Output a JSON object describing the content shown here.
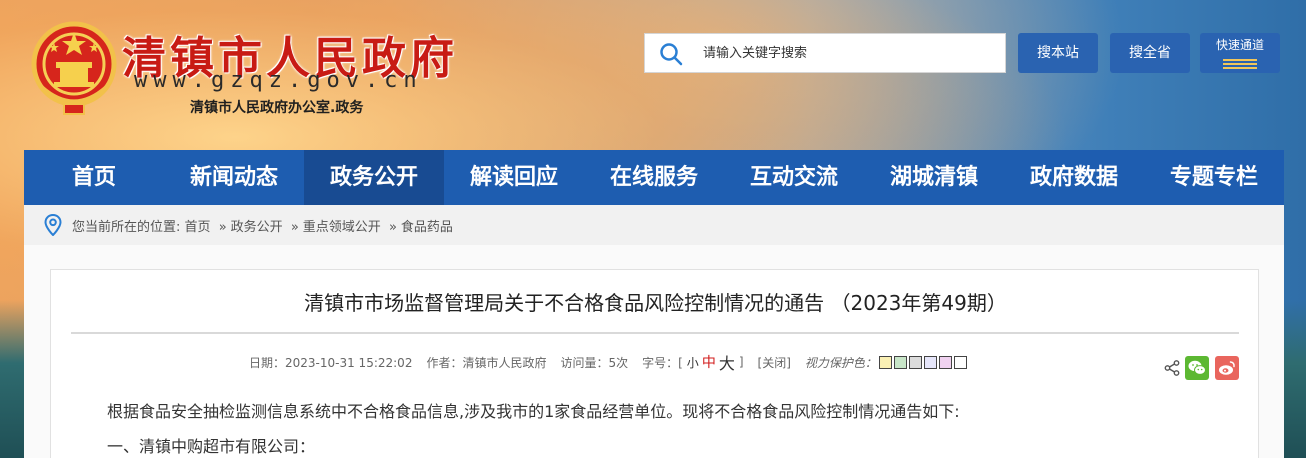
{
  "header": {
    "site_title": "清镇市人民政府",
    "site_url": "www.gzqz.gov.cn",
    "site_org": "清镇市人民政府办公室.政务",
    "search_placeholder": "请输入关键字搜索",
    "btn_search_site": "搜本站",
    "btn_search_province": "搜全省",
    "btn_quick_access": "快速通道"
  },
  "nav": {
    "items": [
      "首页",
      "新闻动态",
      "政务公开",
      "解读回应",
      "在线服务",
      "互动交流",
      "湖城清镇",
      "政府数据",
      "专题专栏"
    ],
    "active_index": 2
  },
  "breadcrumb": {
    "prefix": "您当前所在的位置:",
    "items": [
      "首页",
      "政务公开",
      "重点领域公开",
      "食品药品"
    ],
    "separator": "»"
  },
  "article": {
    "title": "清镇市市场监督管理局关于不合格食品风险控制情况的通告 （2023年第49期）",
    "meta": {
      "date": "日期：2023-10-31 15:22:02",
      "author": "作者：清镇市人民政府",
      "views": "访问量：5次",
      "font_size_label": "字号：[",
      "font_small": "小",
      "font_mid": "中",
      "font_big": "大",
      "font_close": "]",
      "close_label": "[关闭]",
      "vision_label": "视力保护色："
    },
    "vision_colors": [
      "#faf0b4",
      "#c8e6c8",
      "#dcdcdc",
      "#e6e6fa",
      "#f0d2f0",
      "#ffffff"
    ],
    "paragraphs": [
      "根据食品安全抽检监测信息系统中不合格食品信息,涉及我市的1家食品经营单位。现将不合格食品风险控制情况通告如下:",
      "一、清镇中购超市有限公司："
    ]
  },
  "colors": {
    "nav_bg": "#1e5db0",
    "nav_active": "#184b92",
    "title_red": "#c81b14",
    "button_blue": "#2a63b1"
  },
  "icons": [
    "national-emblem-icon",
    "search-icon",
    "location-pin-icon",
    "share-icon",
    "wechat-icon",
    "weibo-icon"
  ]
}
